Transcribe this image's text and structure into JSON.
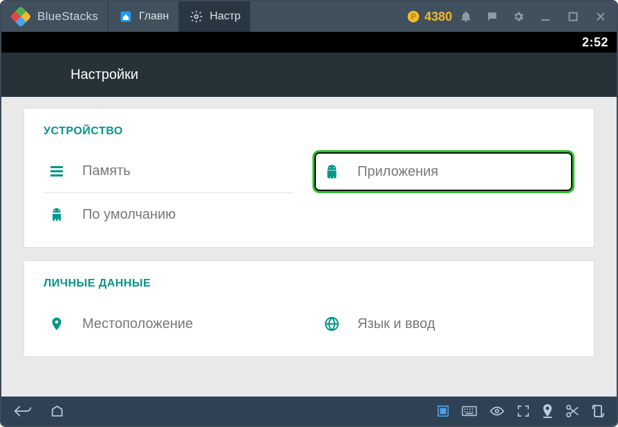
{
  "titlebar": {
    "app_name": "BlueStacks",
    "tab_home_label": "Главн",
    "tab_settings_label": "Настр",
    "coin_count": "4380"
  },
  "android_status": {
    "time": "2:52"
  },
  "settings_header": {
    "title": "Настройки"
  },
  "sections": {
    "device": {
      "title": "УСТРОЙСТВО",
      "storage": "Память",
      "apps": "Приложения",
      "default": "По умолчанию"
    },
    "personal": {
      "title": "ЛИЧНЫЕ ДАННЫЕ",
      "location": "Местоположение",
      "language": "Язык и ввод"
    }
  }
}
